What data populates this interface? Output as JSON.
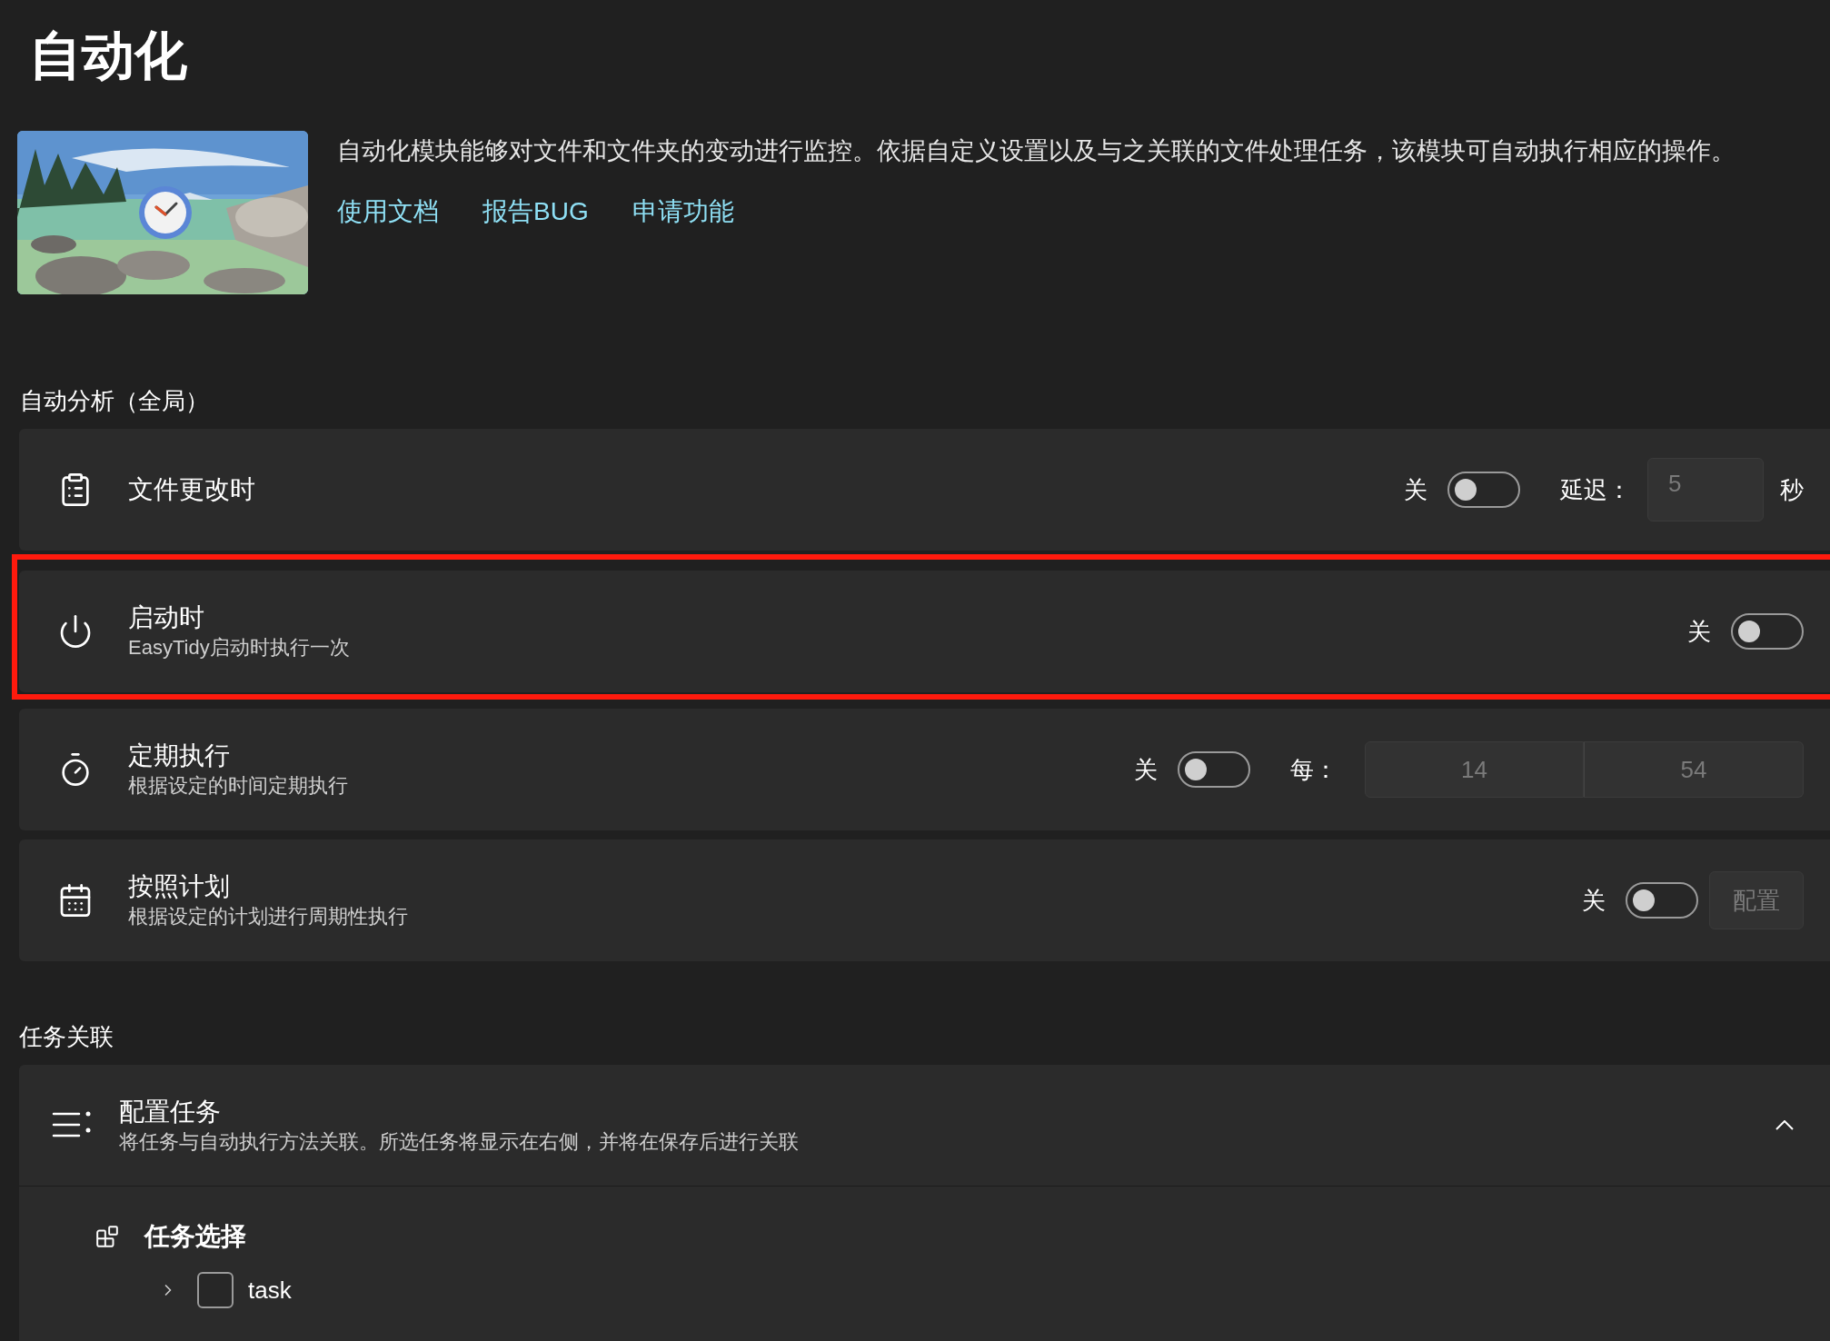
{
  "title": "自动化",
  "intro": {
    "description": "自动化模块能够对文件和文件夹的变动进行监控。依据自定义设置以及与之关联的文件处理任务，该模块可自动执行相应的操作。",
    "links": [
      "使用文档",
      "报告BUG",
      "申请功能"
    ]
  },
  "sections": [
    {
      "header": "自动分析（全局）",
      "rows": [
        {
          "kind": "file_change",
          "title": "文件更改时",
          "highlighted": false,
          "switch": {
            "label": "关",
            "on": false
          },
          "delay": {
            "label": "延迟：",
            "value": "5",
            "disabled": true,
            "unit": "秒"
          }
        },
        {
          "kind": "startup",
          "title": "启动时",
          "subtitle": "EasyTidy启动时执行一次",
          "highlighted": true,
          "switch": {
            "label": "关",
            "on": false
          }
        },
        {
          "kind": "interval",
          "title": "定期执行",
          "subtitle": "根据设定的时间定期执行",
          "highlighted": false,
          "switch": {
            "label": "关",
            "on": false
          },
          "interval": {
            "label": "每：",
            "hours": "14",
            "minutes": "54",
            "disabled": true
          }
        },
        {
          "kind": "schedule",
          "title": "按照计划",
          "subtitle": "根据设定的计划进行周期性执行",
          "highlighted": false,
          "switch": {
            "label": "关",
            "on": false
          },
          "button": {
            "label": "配置",
            "disabled": true
          }
        }
      ]
    }
  ],
  "tasks": {
    "header": "任务关联",
    "expander": {
      "title": "配置任务",
      "subtitle": "将任务与自动执行方法关联。所选任务将显示在右侧，并将在保存后进行关联",
      "expanded": true,
      "group": {
        "title": "任务选择",
        "items": [
          {
            "label": "task",
            "checked": false,
            "expanded": false
          }
        ]
      }
    }
  }
}
